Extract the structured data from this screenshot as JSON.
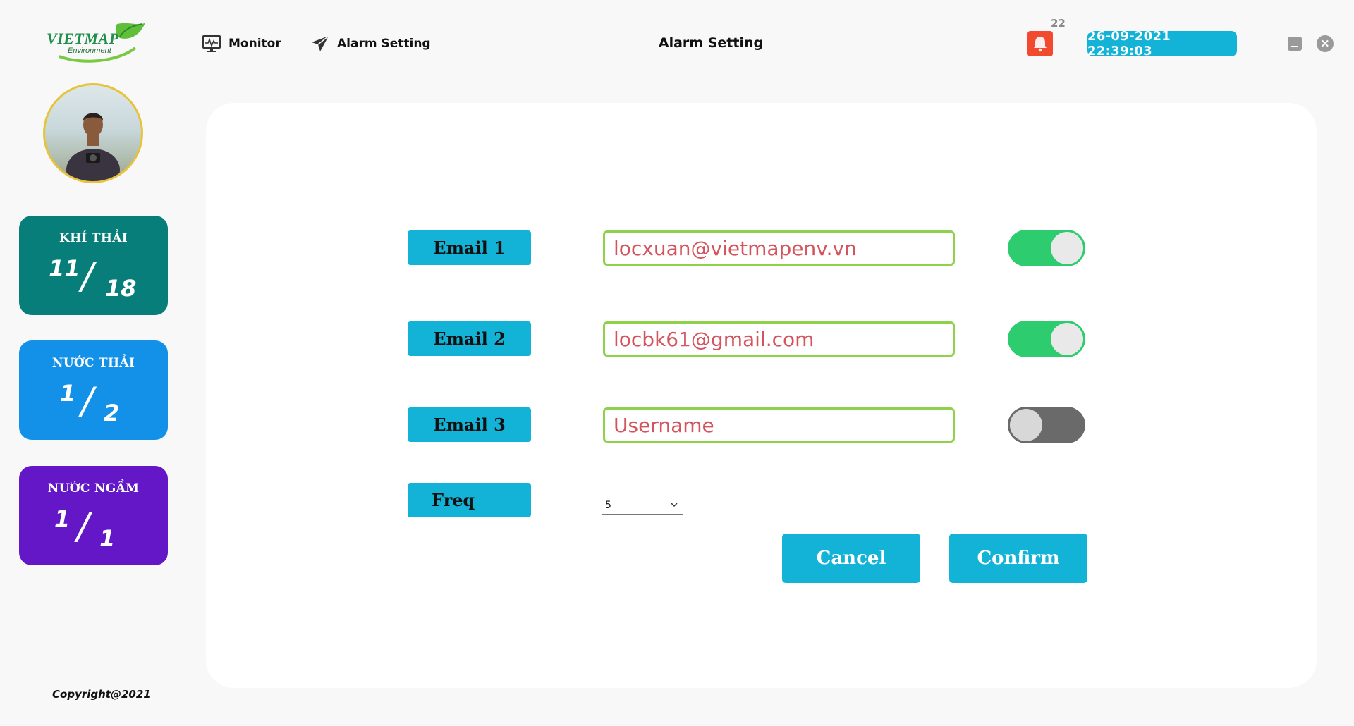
{
  "header": {
    "logo_text": "VIETMAP",
    "logo_subtext": "Environment",
    "nav": [
      {
        "label": "Monitor",
        "icon": "monitor-icon"
      },
      {
        "label": "Alarm Setting",
        "icon": "paper-plane-icon"
      }
    ],
    "page_title": "Alarm Setting",
    "notification_count": "22",
    "datetime": "26-09-2021  22:39:03"
  },
  "sidebar": {
    "cards": [
      {
        "title": "KHÍ THẢI",
        "current": "11",
        "total": "18",
        "color": "#087e7a"
      },
      {
        "title": "NƯỚC THẢI",
        "current": "1",
        "total": "2",
        "color": "#1390e8"
      },
      {
        "title": "NƯỚC NGẦM",
        "current": "1",
        "total": "1",
        "color": "#6417c6"
      }
    ],
    "copyright": "Copyright@2021"
  },
  "form": {
    "rows": [
      {
        "label": "Email 1",
        "value": "locxuan@vietmapenv.vn",
        "placeholder": "Username",
        "enabled": true
      },
      {
        "label": "Email 2",
        "value": "locbk61@gmail.com",
        "placeholder": "Username",
        "enabled": true
      },
      {
        "label": "Email 3",
        "value": "",
        "placeholder": "Username",
        "enabled": false
      }
    ],
    "freq_label": "Freq",
    "freq_value": "5",
    "cancel_label": "Cancel",
    "confirm_label": "Confirm"
  },
  "colors": {
    "accent": "#13b3d8",
    "toggle_on": "#2dcc6e",
    "toggle_off": "#6a6a6a",
    "field_border": "#8fd14b",
    "field_text": "#d4545e",
    "bell": "#f24a2e"
  }
}
